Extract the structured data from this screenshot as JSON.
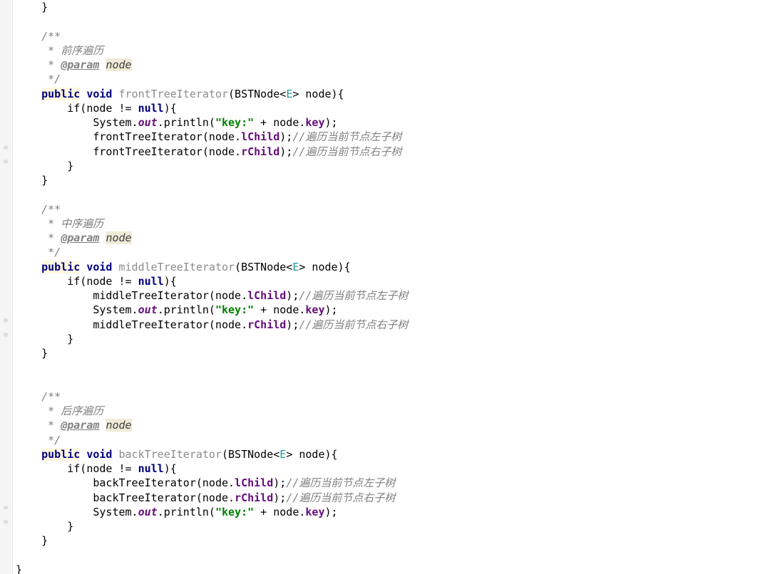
{
  "code": {
    "close_brace_top": "    }",
    "block1": {
      "doc_open": "    /**",
      "doc_desc": "     * 前序遍历",
      "doc_param_prefix": "     * ",
      "doc_param_tag": "@param",
      "doc_param_name": "node",
      "doc_close": "     */",
      "sig_public": "public",
      "sig_void": "void",
      "sig_method": "frontTreeIterator",
      "sig_open": "(BSTNode<",
      "sig_generic": "E",
      "sig_close": "> node){",
      "if_open": "        if(node != ",
      "if_null": "null",
      "if_close": "){",
      "line1_a": "            System.",
      "line1_out": "out",
      "line1_b": ".println(",
      "line1_str": "\"key:\"",
      "line1_c": " + node.",
      "line1_field": "key",
      "line1_d": ");",
      "line2_a": "            frontTreeIterator(node.",
      "line2_field": "lChild",
      "line2_b": ");",
      "line2_comment": "//遍历当前节点左子树",
      "line3_a": "            frontTreeIterator(node.",
      "line3_field": "rChild",
      "line3_b": ");",
      "line3_comment": "//遍历当前节点右子树",
      "brace1": "        }",
      "brace2": "    }"
    },
    "block2": {
      "doc_open": "    /**",
      "doc_desc": "     * 中序遍历",
      "doc_param_prefix": "     * ",
      "doc_param_tag": "@param",
      "doc_param_name": "node",
      "doc_close": "     */",
      "sig_public": "public",
      "sig_void": "void",
      "sig_method": "middleTreeIterator",
      "sig_open": "(BSTNode<",
      "sig_generic": "E",
      "sig_close": "> node){",
      "if_open": "        if(node != ",
      "if_null": "null",
      "if_close": "){",
      "line1_a": "            middleTreeIterator(node.",
      "line1_field": "lChild",
      "line1_b": ");",
      "line1_comment": "//遍历当前节点左子树",
      "line2_a": "            System.",
      "line2_out": "out",
      "line2_b": ".println(",
      "line2_str": "\"key:\"",
      "line2_c": " + node.",
      "line2_field": "key",
      "line2_d": ");",
      "line3_a": "            middleTreeIterator(node.",
      "line3_field": "rChild",
      "line3_b": ");",
      "line3_comment": "//遍历当前节点右子树",
      "brace1": "        }",
      "brace2": "    }"
    },
    "block3": {
      "doc_open": "    /**",
      "doc_desc": "     * 后序遍历",
      "doc_param_prefix": "     * ",
      "doc_param_tag": "@param",
      "doc_param_name": "node",
      "doc_close": "     */",
      "sig_public": "public",
      "sig_void": "void",
      "sig_method": "backTreeIterator",
      "sig_open": "(BSTNode<",
      "sig_generic": "E",
      "sig_close": "> node){",
      "if_open": "        if(node != ",
      "if_null": "null",
      "if_close": "){",
      "line1_a": "            backTreeIterator(node.",
      "line1_field": "lChild",
      "line1_b": ");",
      "line1_comment": "//遍历当前节点左子树",
      "line2_a": "            backTreeIterator(node.",
      "line2_field": "rChild",
      "line2_b": ");",
      "line2_comment": "//遍历当前节点右子树",
      "line3_a": "            System.",
      "line3_out": "out",
      "line3_b": ".println(",
      "line3_str": "\"key:\"",
      "line3_c": " + node.",
      "line3_field": "key",
      "line3_d": ");",
      "brace1": "        }",
      "brace2": "    }"
    },
    "close_brace_bottom": "}"
  }
}
